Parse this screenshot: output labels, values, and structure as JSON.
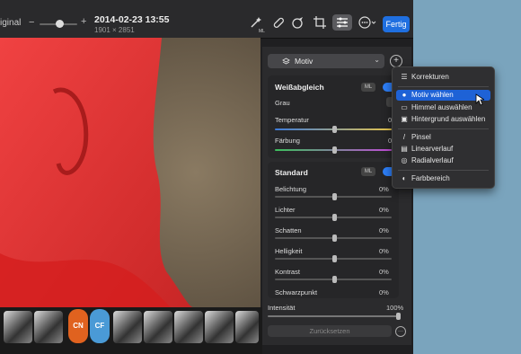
{
  "toolbar": {
    "original_label": "iginal",
    "zoom_minus": "−",
    "zoom_plus": "+",
    "zoom_level": 0.5,
    "date": "2014-02-23 13:55",
    "dimensions": "1901 × 2851",
    "icons": [
      "magic-ml-icon",
      "bandage-icon",
      "retouch-icon",
      "crop-icon",
      "adjust-icon",
      "more-icon"
    ],
    "ml_tag": "ML",
    "done_label": "Fertig"
  },
  "filmstrip": {
    "badges": [
      {
        "label": "CN",
        "color": "#e0621f"
      },
      {
        "label": "CF",
        "color": "#4a9ad6"
      }
    ]
  },
  "panel": {
    "mask_select": "Motiv",
    "whitebalance": {
      "title": "Weißabgleich",
      "ml": "ML",
      "rows": [
        {
          "label": "Grau",
          "value": ""
        },
        {
          "label": "Temperatur",
          "value": "0"
        },
        {
          "label": "Färbung",
          "value": "0"
        }
      ]
    },
    "standard": {
      "title": "Standard",
      "ml": "ML",
      "rows": [
        {
          "label": "Belichtung",
          "value": "0%"
        },
        {
          "label": "Lichter",
          "value": "0%"
        },
        {
          "label": "Schatten",
          "value": "0%"
        },
        {
          "label": "Helligkeit",
          "value": "0%"
        },
        {
          "label": "Kontrast",
          "value": "0%"
        },
        {
          "label": "Schwarzpunkt",
          "value": "0%"
        }
      ]
    },
    "intensity": {
      "label": "Intensität",
      "value": "100%"
    },
    "reset_label": "Zurücksetzen"
  },
  "menu": {
    "items": [
      {
        "label": "Korrekturen",
        "icon": "sliders-icon"
      },
      {
        "label": "Motiv wählen",
        "icon": "person-icon",
        "selected": true
      },
      {
        "label": "Himmel auswählen",
        "icon": "sky-icon"
      },
      {
        "label": "Hintergrund auswählen",
        "icon": "background-icon"
      },
      {
        "label": "Pinsel",
        "icon": "brush-icon"
      },
      {
        "label": "Linearverlauf",
        "icon": "linear-gradient-icon"
      },
      {
        "label": "Radialverlauf",
        "icon": "radial-gradient-icon"
      },
      {
        "label": "Farbbereich",
        "icon": "color-range-icon"
      }
    ]
  }
}
